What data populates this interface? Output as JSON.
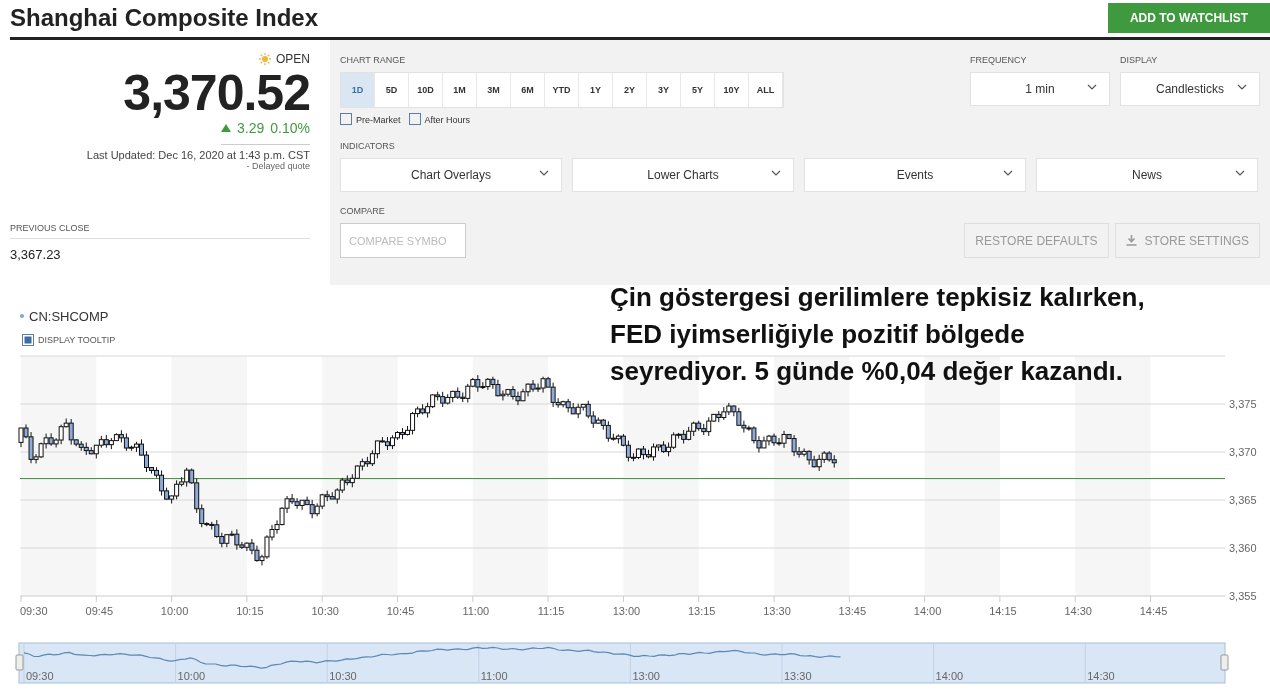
{
  "header": {
    "title": "Shanghai Composite Index",
    "watchlist_button": "ADD TO WATCHLIST"
  },
  "quote": {
    "market_status": "OPEN",
    "price": "3,370.52",
    "change": "3.29",
    "change_percent": "0.10%",
    "last_updated": "Last Updated: Dec 16, 2020 at 1:43 p.m. CST",
    "delay_note": "-  Delayed quote",
    "previous_close_label": "PREVIOUS CLOSE",
    "previous_close": "3,367.23"
  },
  "controls": {
    "chart_range": {
      "label": "CHART RANGE",
      "options": [
        {
          "label": "1D",
          "selected": true
        },
        {
          "label": "5D",
          "selected": false
        },
        {
          "label": "10D",
          "selected": false
        },
        {
          "label": "1M",
          "selected": false
        },
        {
          "label": "3M",
          "selected": false
        },
        {
          "label": "6M",
          "selected": false
        },
        {
          "label": "YTD",
          "selected": false
        },
        {
          "label": "1Y",
          "selected": false
        },
        {
          "label": "2Y",
          "selected": false
        },
        {
          "label": "3Y",
          "selected": false
        },
        {
          "label": "5Y",
          "selected": false
        },
        {
          "label": "10Y",
          "selected": false
        },
        {
          "label": "ALL",
          "selected": false
        }
      ]
    },
    "extended_hours": [
      {
        "label": "Pre-Market",
        "checked": false
      },
      {
        "label": "After Hours",
        "checked": false
      }
    ],
    "frequency": {
      "label": "FREQUENCY",
      "value": "1 min"
    },
    "display": {
      "label": "DISPLAY",
      "value": "Candlesticks"
    },
    "indicators": {
      "label": "INDICATORS",
      "dropdowns": [
        "Chart Overlays",
        "Lower Charts",
        "Events",
        "News"
      ]
    },
    "compare": {
      "label": "COMPARE",
      "placeholder": "COMPARE SYMBO"
    },
    "buttons": [
      {
        "label": "RESTORE DEFAULTS"
      },
      {
        "label": "STORE SETTINGS"
      }
    ]
  },
  "chart": {
    "symbol": "CN:SHCOMP",
    "tooltip": {
      "label": "DISPLAY TOOLTIP",
      "checked": true
    },
    "y_labels": [
      "3,375",
      "3,370",
      "3,365",
      "3,360",
      "3,355"
    ],
    "x_labels": [
      "09:30",
      "09:45",
      "10:00",
      "10:15",
      "10:30",
      "10:45",
      "11:00",
      "11:15",
      "13:00",
      "13:15",
      "13:30",
      "13:45",
      "14:00",
      "14:15",
      "14:30",
      "14:45"
    ],
    "navigator_labels": [
      "09:30",
      "10:00",
      "10:30",
      "11:00",
      "13:00",
      "13:30",
      "14:00",
      "14:30"
    ]
  },
  "annotation": "Çin göstergesi gerilimlere tepkisiz kalırken, FED iyimserliğiyle pozitif bölgede seyrediyor. 5 günde %0,04 değer kazandı."
}
